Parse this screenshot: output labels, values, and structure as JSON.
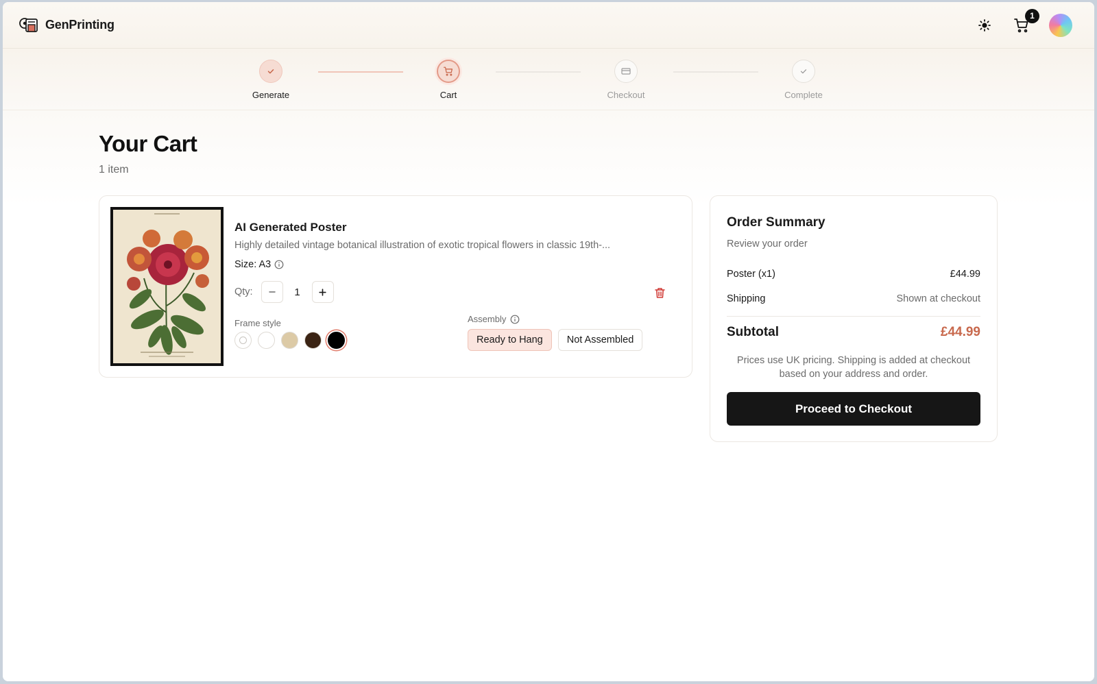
{
  "brand": {
    "name": "GenPrinting",
    "logo_icon": "print-logo-icon"
  },
  "header": {
    "theme_icon": "sun-icon",
    "cart_icon": "cart-icon",
    "cart_count": "1"
  },
  "steps": [
    {
      "label": "Generate",
      "state": "done",
      "icon": "check-icon"
    },
    {
      "label": "Cart",
      "state": "active",
      "icon": "cart-icon"
    },
    {
      "label": "Checkout",
      "state": "pending",
      "icon": "credit-card-icon"
    },
    {
      "label": "Complete",
      "state": "pending",
      "icon": "check-icon"
    }
  ],
  "page": {
    "title": "Your Cart",
    "item_count": "1 item"
  },
  "cart_item": {
    "title": "AI Generated Poster",
    "description": "Highly detailed vintage botanical illustration of exotic tropical flowers in classic 19th-...",
    "size": "Size: A3",
    "qty_label": "Qty:",
    "qty": "1",
    "frame_label": "Frame style",
    "frame_options": [
      {
        "name": "no-frame",
        "color": "#ffffff",
        "selected": false
      },
      {
        "name": "white",
        "color": "#ffffff",
        "selected": false
      },
      {
        "name": "natural",
        "color": "#dccaa6",
        "selected": false
      },
      {
        "name": "walnut",
        "color": "#3b2414",
        "selected": false
      },
      {
        "name": "black",
        "color": "#000000",
        "selected": true
      }
    ],
    "assembly_label": "Assembly",
    "assembly_options": [
      {
        "label": "Ready to Hang",
        "selected": true
      },
      {
        "label": "Not Assembled",
        "selected": false
      }
    ]
  },
  "summary": {
    "title": "Order Summary",
    "subtitle": "Review your order",
    "rows": [
      {
        "label": "Poster (x1)",
        "value": "£44.99"
      },
      {
        "label": "Shipping",
        "value": "Shown at checkout"
      }
    ],
    "subtotal_label": "Subtotal",
    "subtotal_value": "£44.99",
    "note": "Prices use UK pricing. Shipping is added at checkout based on your address and order.",
    "checkout_label": "Proceed to Checkout"
  },
  "colors": {
    "accent": "#c8694d",
    "accent_light": "#fbe5df",
    "dark": "#161616"
  }
}
